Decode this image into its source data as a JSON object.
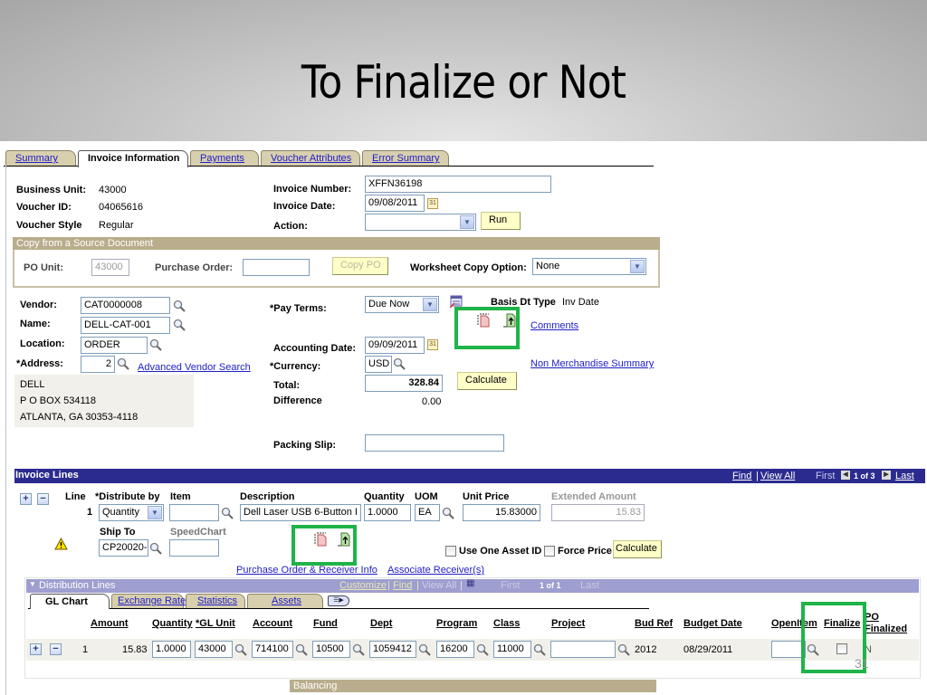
{
  "slide": {
    "title": "To Finalize or Not",
    "page_number": "31"
  },
  "tabs": [
    {
      "label": "Summary",
      "active": false
    },
    {
      "label": "Invoice Information",
      "active": true
    },
    {
      "label": "Payments",
      "active": false
    },
    {
      "label": "Voucher Attributes",
      "active": false
    },
    {
      "label": "Error Summary",
      "active": false
    }
  ],
  "header": {
    "business_unit_label": "Business Unit:",
    "business_unit": "43000",
    "voucher_id_label": "Voucher ID:",
    "voucher_id": "04065616",
    "voucher_style_label": "Voucher Style",
    "voucher_style": "Regular",
    "invoice_number_label": "Invoice Number:",
    "invoice_number": "XFFN36198",
    "invoice_date_label": "Invoice Date:",
    "invoice_date": "09/08/2011",
    "action_label": "Action:",
    "action_value": "",
    "run_button": "Run"
  },
  "copy_source": {
    "title": "Copy from a Source Document",
    "po_unit_label": "PO Unit:",
    "po_unit": "43000",
    "purchase_order_label": "Purchase Order:",
    "purchase_order": "",
    "copy_po_button": "Copy PO",
    "worksheet_label": "Worksheet Copy Option:",
    "worksheet_value": "None"
  },
  "vendor": {
    "vendor_label": "Vendor:",
    "vendor": "CAT0000008",
    "name_label": "Name:",
    "name": "DELL-CAT-001",
    "location_label": "Location:",
    "location": "ORDER",
    "address_label": "*Address:",
    "address": "2",
    "advanced_search_link": "Advanced Vendor Search",
    "address_lines": [
      "DELL",
      "P O BOX 534118",
      "ATLANTA, GA  30353-4118"
    ]
  },
  "terms": {
    "pay_terms_label": "*Pay Terms:",
    "pay_terms": "Due Now",
    "basis_label": "Basis Dt Type",
    "basis_value": "Inv Date",
    "comments_link": "Comments",
    "accounting_date_label": "Accounting Date:",
    "accounting_date": "09/09/2011",
    "currency_label": "*Currency:",
    "currency": "USD",
    "non_merch_link": "Non Merchandise Summary",
    "total_label": "Total:",
    "total": "328.84",
    "calculate_button": "Calculate",
    "difference_label": "Difference",
    "difference": "0.00",
    "packing_slip_label": "Packing Slip:",
    "packing_slip": ""
  },
  "invoice_lines": {
    "title": "Invoice Lines",
    "find_link": "Find",
    "view_all_link": "View All",
    "first_label": "First",
    "page_info": "1 of 3",
    "last_link": "Last",
    "columns": {
      "line": "Line",
      "distribute_by": "*Distribute by",
      "item": "Item",
      "description": "Description",
      "quantity": "Quantity",
      "uom": "UOM",
      "unit_price": "Unit Price",
      "extended_amount": "Extended Amount",
      "ship_to": "Ship To",
      "speedchart": "SpeedChart"
    },
    "row": {
      "line": "1",
      "distribute_by": "Quantity",
      "item": "",
      "description": "Dell Laser USB 6-Button I",
      "quantity": "1.0000",
      "uom": "EA",
      "unit_price": "15.83000",
      "extended_amount": "15.83",
      "ship_to": "CP20020-",
      "speedchart": ""
    },
    "use_one_asset_label": "Use One Asset ID",
    "force_price_label": "Force Price",
    "calculate_button": "Calculate",
    "po_receiver_link": "Purchase Order & Receiver Info",
    "associate_link": "Associate Receiver(s)"
  },
  "distribution": {
    "title": "Distribution Lines",
    "customize_link": "Customize",
    "find_link": "Find",
    "view_all_link": "View All",
    "first_label": "First",
    "page_info": "1 of 1",
    "last_label": "Last",
    "tabs": [
      {
        "label": "GL Chart",
        "active": true
      },
      {
        "label": "Exchange Rate",
        "active": false
      },
      {
        "label": "Statistics",
        "active": false
      },
      {
        "label": "Assets",
        "active": false
      }
    ],
    "columns": [
      "Amount",
      "Quantity",
      "*GL Unit",
      "Account",
      "Fund",
      "Dept",
      "Program",
      "Class",
      "Project",
      "Bud Ref",
      "Budget Date",
      "OpenItem",
      "Finalize",
      "PO Finalized"
    ],
    "row": {
      "line": "1",
      "amount": "15.83",
      "quantity": "1.0000",
      "gl_unit": "43000",
      "account": "714100",
      "fund": "10500",
      "dept": "1059412",
      "program": "16200",
      "class": "11000",
      "project": "",
      "bud_ref": "2012",
      "budget_date": "08/29/2011",
      "open_item": "",
      "finalize": false,
      "po_finalized": "N"
    }
  },
  "balancing": {
    "title": "Balancing"
  },
  "colors": {
    "highlight": "#1fb449",
    "bar_blue": "#2b2b8f",
    "bar_lavender": "#9e9ed0",
    "group_tan": "#b9ad8d",
    "button_yellow": "#ffffc8"
  }
}
